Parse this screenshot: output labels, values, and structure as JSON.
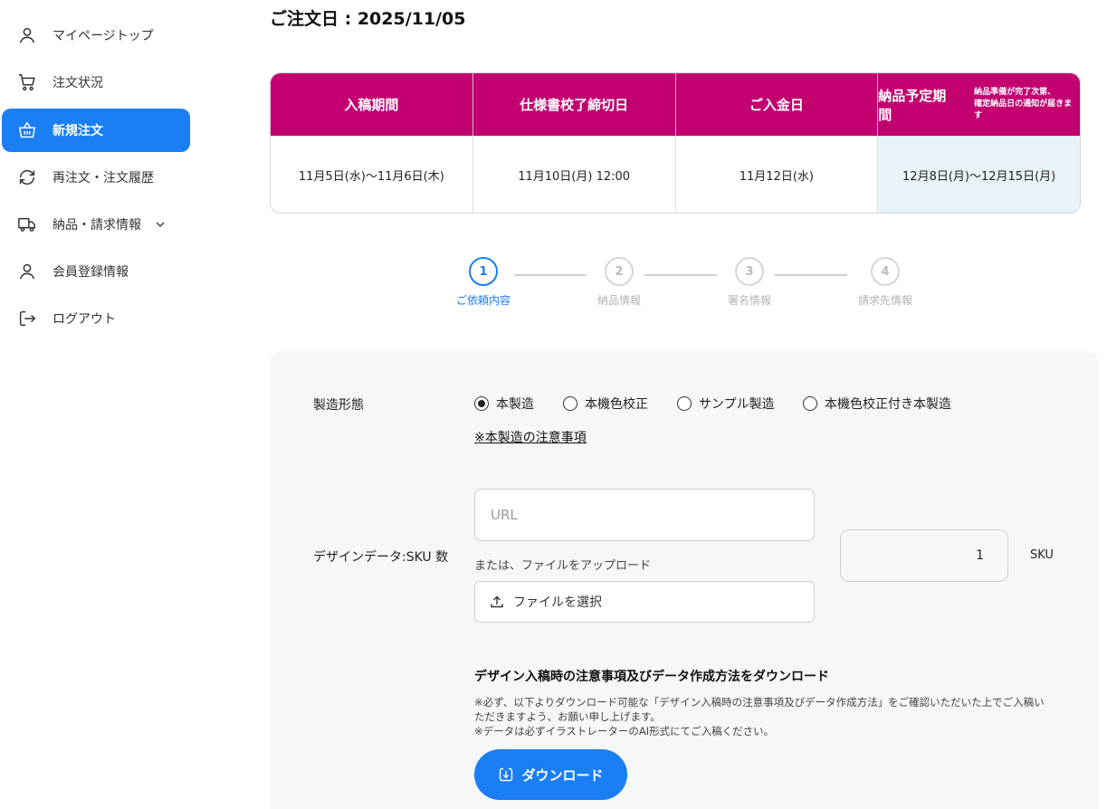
{
  "sidebar": {
    "items": [
      {
        "label": "マイページトップ",
        "icon": "user-icon"
      },
      {
        "label": "注文状況",
        "icon": "cart-icon"
      },
      {
        "label": "新規注文",
        "icon": "basket-icon",
        "active": true
      },
      {
        "label": "再注文・注文履歴",
        "icon": "refresh-icon"
      },
      {
        "label": "納品・請求情報",
        "icon": "truck-icon",
        "expandable": true
      },
      {
        "label": "会員登録情報",
        "icon": "user-icon"
      },
      {
        "label": "ログアウト",
        "icon": "logout-icon"
      }
    ]
  },
  "main": {
    "order_date": "ご注文日 : 2025/11/05"
  },
  "schedule": {
    "headers": [
      "入稿期間",
      "仕様書校了締切日",
      "ご入金日",
      "納品予定期間"
    ],
    "delivery_note_line1": "納品準備が完了次第、",
    "delivery_note_line2": "確定納品日の通知が届きます",
    "values": [
      "11月5日(水)〜11月6日(木)",
      "11月10日(月) 12:00",
      "11月12日(水)",
      "12月8日(月)〜12月15日(月)"
    ],
    "header_color": "#c3006f",
    "highlight_color": "#e7f2f9"
  },
  "stepper": {
    "current": 1,
    "steps": [
      {
        "number": "1",
        "label": "ご依頼内容"
      },
      {
        "number": "2",
        "label": "納品情報"
      },
      {
        "number": "3",
        "label": "署名情報"
      },
      {
        "number": "4",
        "label": "請求先情報"
      }
    ]
  },
  "form": {
    "manufacturing_label": "製造形態",
    "options": [
      "本製造",
      "本機色校正",
      "サンプル製造",
      "本機色校正付き本製造"
    ],
    "selected_option": "本製造",
    "caution_link": "※本製造の注意事項",
    "design_label": "デザインデータ:SKU 数",
    "url_placeholder": "URL",
    "or_upload": "または、ファイルをアップロード",
    "file_button": "ファイルを選択",
    "sku_value": "1",
    "sku_unit": "SKU",
    "download_title": "デザイン入稿時の注意事項及びデータ作成方法をダウンロード",
    "download_desc_1": "※必ず、以下よりダウンロード可能な「デザイン入稿時の注意事項及びデータ作成方法」をご確認いただいた上でご入稿いただきますよう、お願い申し上げます。",
    "download_desc_2": "※データは必ずイラストレーターのAI形式にてご入稿ください。",
    "download_button": "ダウンロード"
  },
  "colors": {
    "accent": "#1a7ef5",
    "brand": "#c3006f"
  }
}
